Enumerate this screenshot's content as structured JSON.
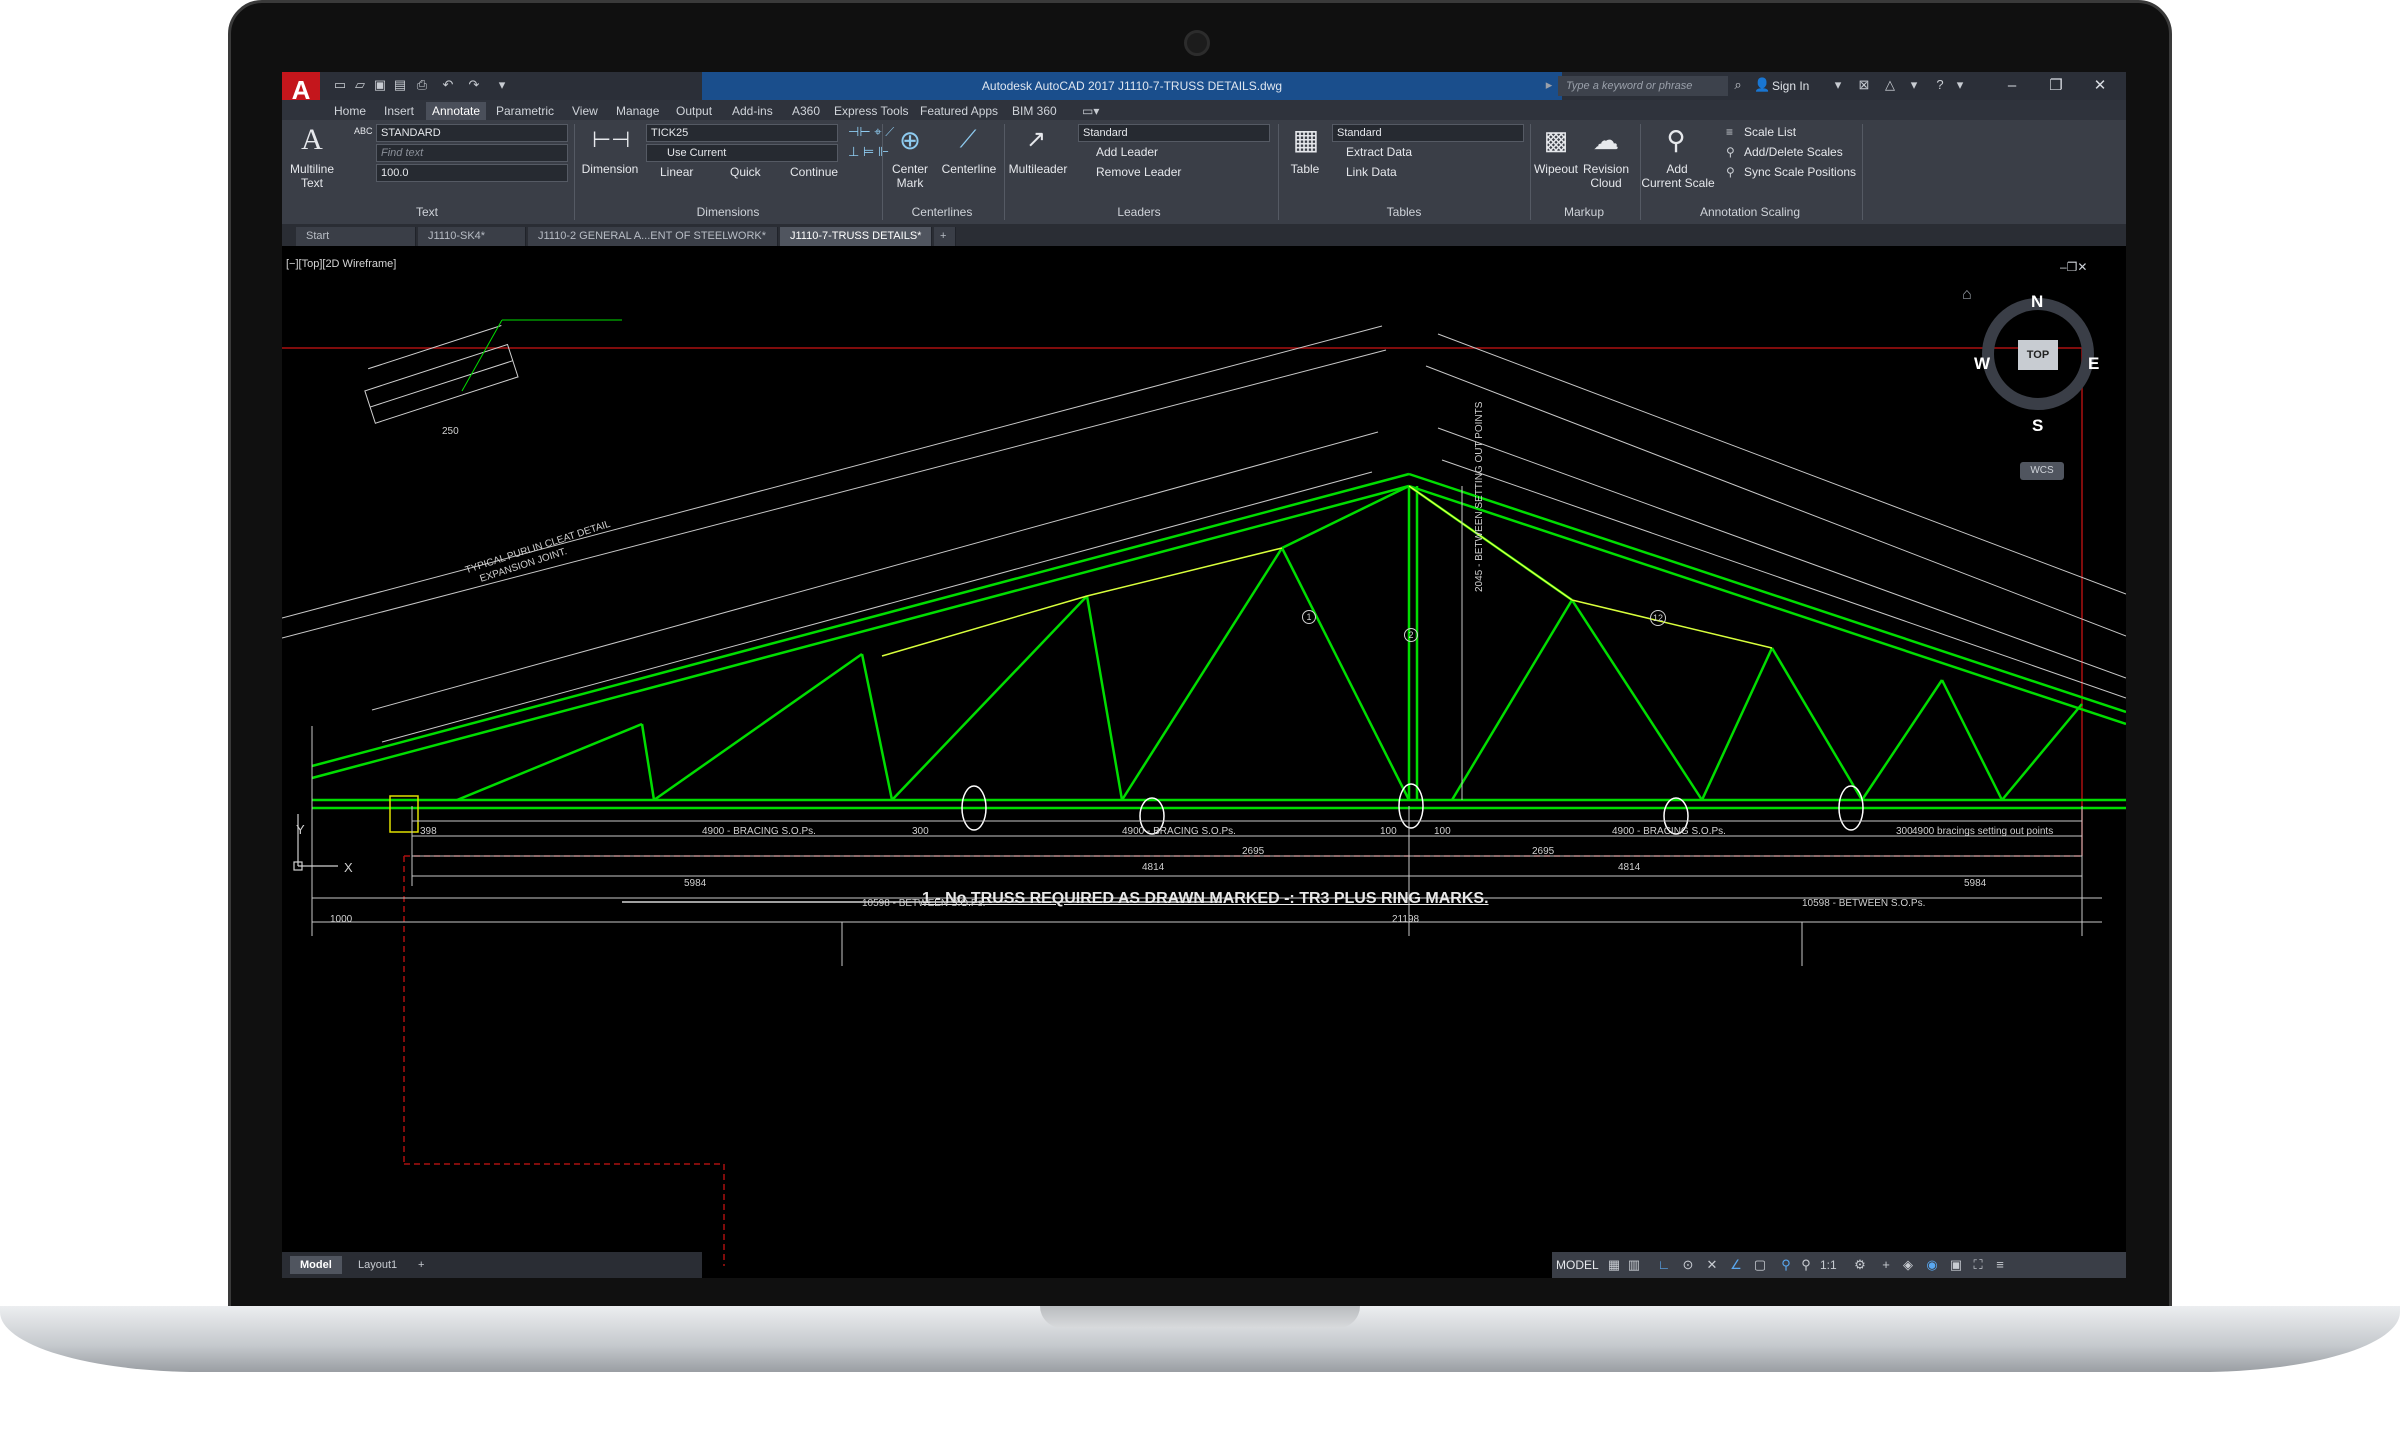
{
  "app": {
    "logo": "A",
    "window_title": "Autodesk AutoCAD 2017    J1110-7-TRUSS DETAILS.dwg",
    "search_placeholder": "Type a keyword or phrase",
    "sign_in": "Sign In"
  },
  "menu_tabs": [
    "Home",
    "Insert",
    "Annotate",
    "Parametric",
    "View",
    "Manage",
    "Output",
    "Add-ins",
    "A360",
    "Express Tools",
    "Featured Apps",
    "BIM 360"
  ],
  "ribbon": {
    "text_panel": {
      "multiline_text": "Multiline",
      "multiline_text2": "Text",
      "style": "STANDARD",
      "find_placeholder": "Find text",
      "height": "100.0",
      "label": "Text"
    },
    "dimension_panel": {
      "dimension": "Dimension",
      "dimstyle": "TICK25",
      "use_current": "Use Current",
      "linear": "Linear",
      "quick": "Quick",
      "continue": "Continue",
      "label": "Dimensions"
    },
    "centerlines_panel": {
      "center_mark": "Center",
      "center_mark2": "Mark",
      "centerline": "Centerline",
      "label": "Centerlines"
    },
    "leaders_panel": {
      "multileader": "Multileader",
      "style": "Standard",
      "add_leader": "Add Leader",
      "remove_leader": "Remove Leader",
      "label": "Leaders"
    },
    "tables_panel": {
      "table": "Table",
      "style": "Standard",
      "extract_data": "Extract Data",
      "link_data": "Link Data",
      "label": "Tables"
    },
    "markup_panel": {
      "wipeout": "Wipeout",
      "revision_cloud": "Revision",
      "revision_cloud2": "Cloud",
      "label": "Markup"
    },
    "scaling_panel": {
      "add_current_scale": "Add",
      "add_current_scale2": "Current Scale",
      "scale_list": "Scale List",
      "add_delete_scales": "Add/Delete Scales",
      "sync_scale_positions": "Sync Scale Positions",
      "label": "Annotation Scaling"
    }
  },
  "file_tabs": [
    "Start",
    "J1110-SK4*",
    "J1110-2 GENERAL A...ENT OF STEELWORK*",
    "J1110-7-TRUSS DETAILS*"
  ],
  "viewport": {
    "label": "[−][Top][2D Wireframe]"
  },
  "viewcube": {
    "n": "N",
    "s": "S",
    "e": "E",
    "w": "W",
    "top": "TOP",
    "wcs": "WCS"
  },
  "drawing": {
    "main_note": "1 - No TRUSS REQUIRED AS DRAWN MARKED -: TR3  PLUS RING MARKS.",
    "cleat_title": "TYPICAL PURLIN CLEAT DETAIL",
    "cleat_subtitle": "EXPANSION JOINT.",
    "dim_21198": "21198",
    "dim_1000": "1000",
    "dim_10598_l": "10598 - BETWEEN S.O.Ps.",
    "dim_10598_r": "10598 - BETWEEN S.O.Ps.",
    "dim_5984_l": "5984",
    "dim_5984_r": "5984",
    "dim_4814_l": "4814",
    "dim_4814_r": "4814",
    "dim_2695_l": "2695",
    "dim_2695_r": "2695",
    "dim_4900_l": "4900 - BRACING S.O.Ps.",
    "dim_4900_m": "4900 - BRACING S.O.Ps.",
    "dim_4900_r": "4900 - BRACING S.O.Ps.",
    "dim_4900_rr": "4900 bracings setting out points",
    "dim_398": "398",
    "dim_300_a": "300",
    "dim_300_b": "300",
    "dim_100_a": "100",
    "dim_100_b": "100",
    "dim_250": "250",
    "dim_2045": "2045 - BETWEEN SETTING OUT POINTS",
    "node_1": "1",
    "node_2": "2",
    "node_12": "12",
    "axis_x": "X",
    "axis_y": "Y"
  },
  "layout_tabs": [
    "Model",
    "Layout1"
  ],
  "status": {
    "model": "MODEL",
    "scale": "1:1"
  },
  "colors": {
    "truss": "#00dd00",
    "truss_hi": "#d8ff3c",
    "dims": "#d8d8d8",
    "frame": "#aa1010"
  }
}
